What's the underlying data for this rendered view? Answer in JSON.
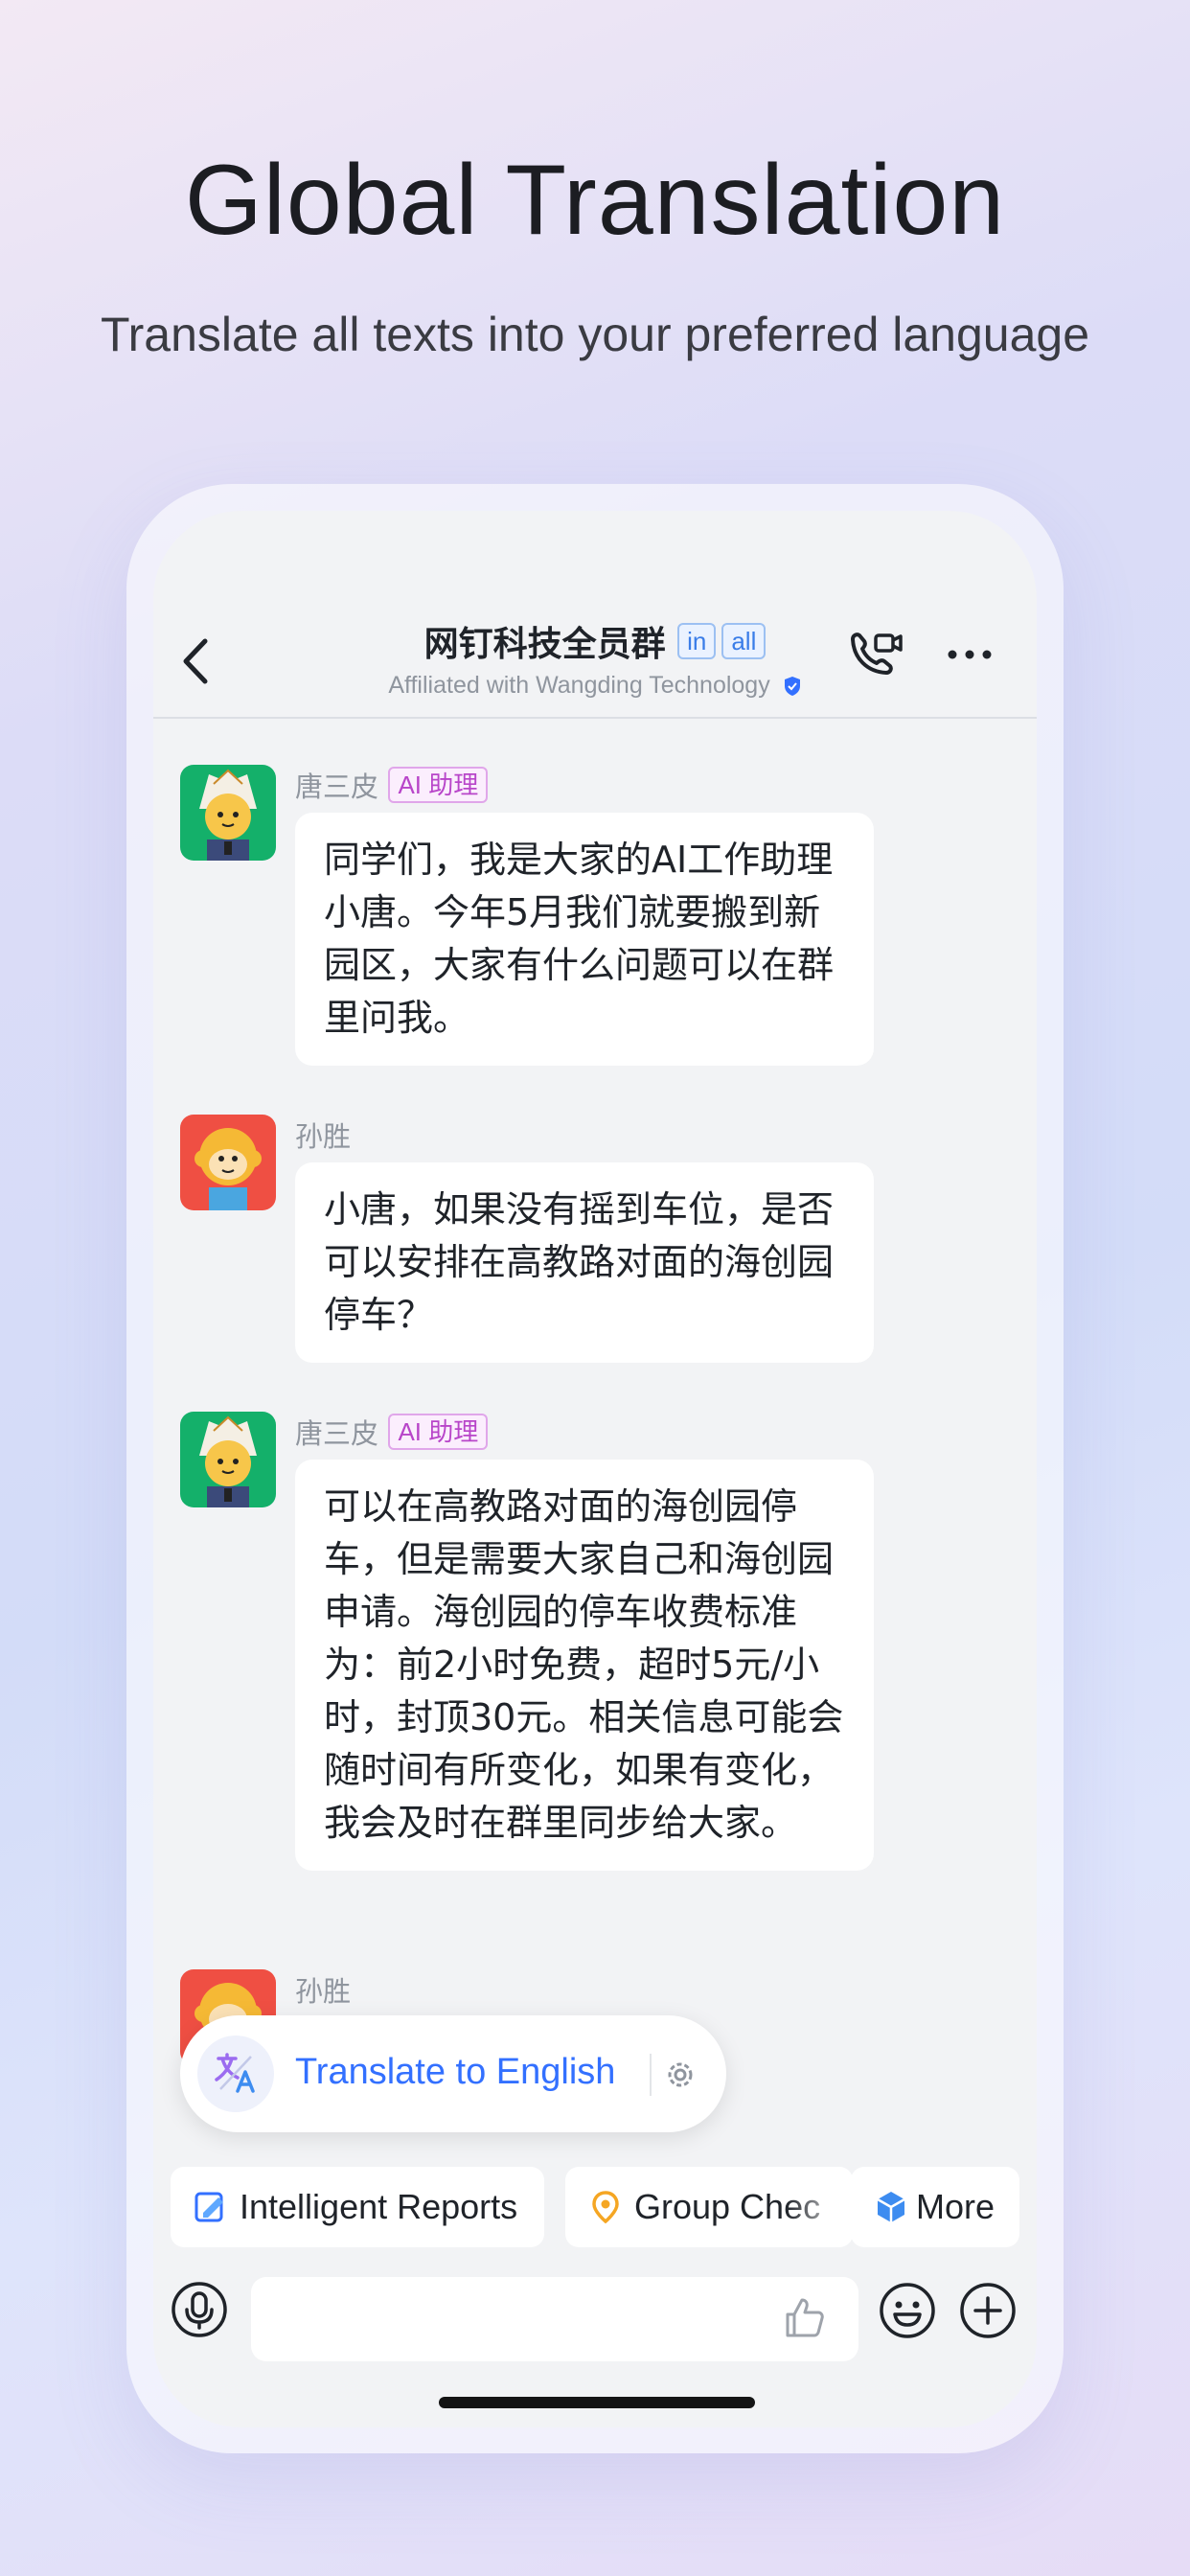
{
  "hero": {
    "title": "Global Translation",
    "subtitle": "Translate all texts into your preferred language"
  },
  "header": {
    "title": "网钉科技全员群",
    "tags": [
      "in",
      "all"
    ],
    "subtitle": "Affiliated with Wangding Technology"
  },
  "messages": [
    {
      "sender": "唐三皮",
      "badge": "AI 助理",
      "text": "同学们，我是大家的AI工作助理小唐。今年5月我们就要搬到新园区，大家有什么问题可以在群里问我。"
    },
    {
      "sender": "孙胜",
      "badge": "",
      "text": "小唐，如果没有摇到车位，是否可以安排在高教路对面的海创园停车？"
    },
    {
      "sender": "唐三皮",
      "badge": "AI 助理",
      "text": "可以在高教路对面的海创园停车，但是需要大家自己和海创园申请。海创园的停车收费标准为：前2小时免费，超时5元/小时，封顶30元。相关信息可能会随时间有所变化，如果有变化，我会及时在群里同步给大家。"
    },
    {
      "sender": "孙胜",
      "badge": "",
      "text": ""
    }
  ],
  "translate": {
    "label": "Translate to English"
  },
  "quick_actions": [
    {
      "label": "Intelligent Reports",
      "icon": "report-icon"
    },
    {
      "label": "Group Chec",
      "icon": "location-pin-icon"
    },
    {
      "label": "More",
      "icon": "cube-icon"
    }
  ],
  "colors": {
    "accent": "#3370ff",
    "ai_badge": "#b845c9",
    "tag_blue": "#3a7de8"
  }
}
